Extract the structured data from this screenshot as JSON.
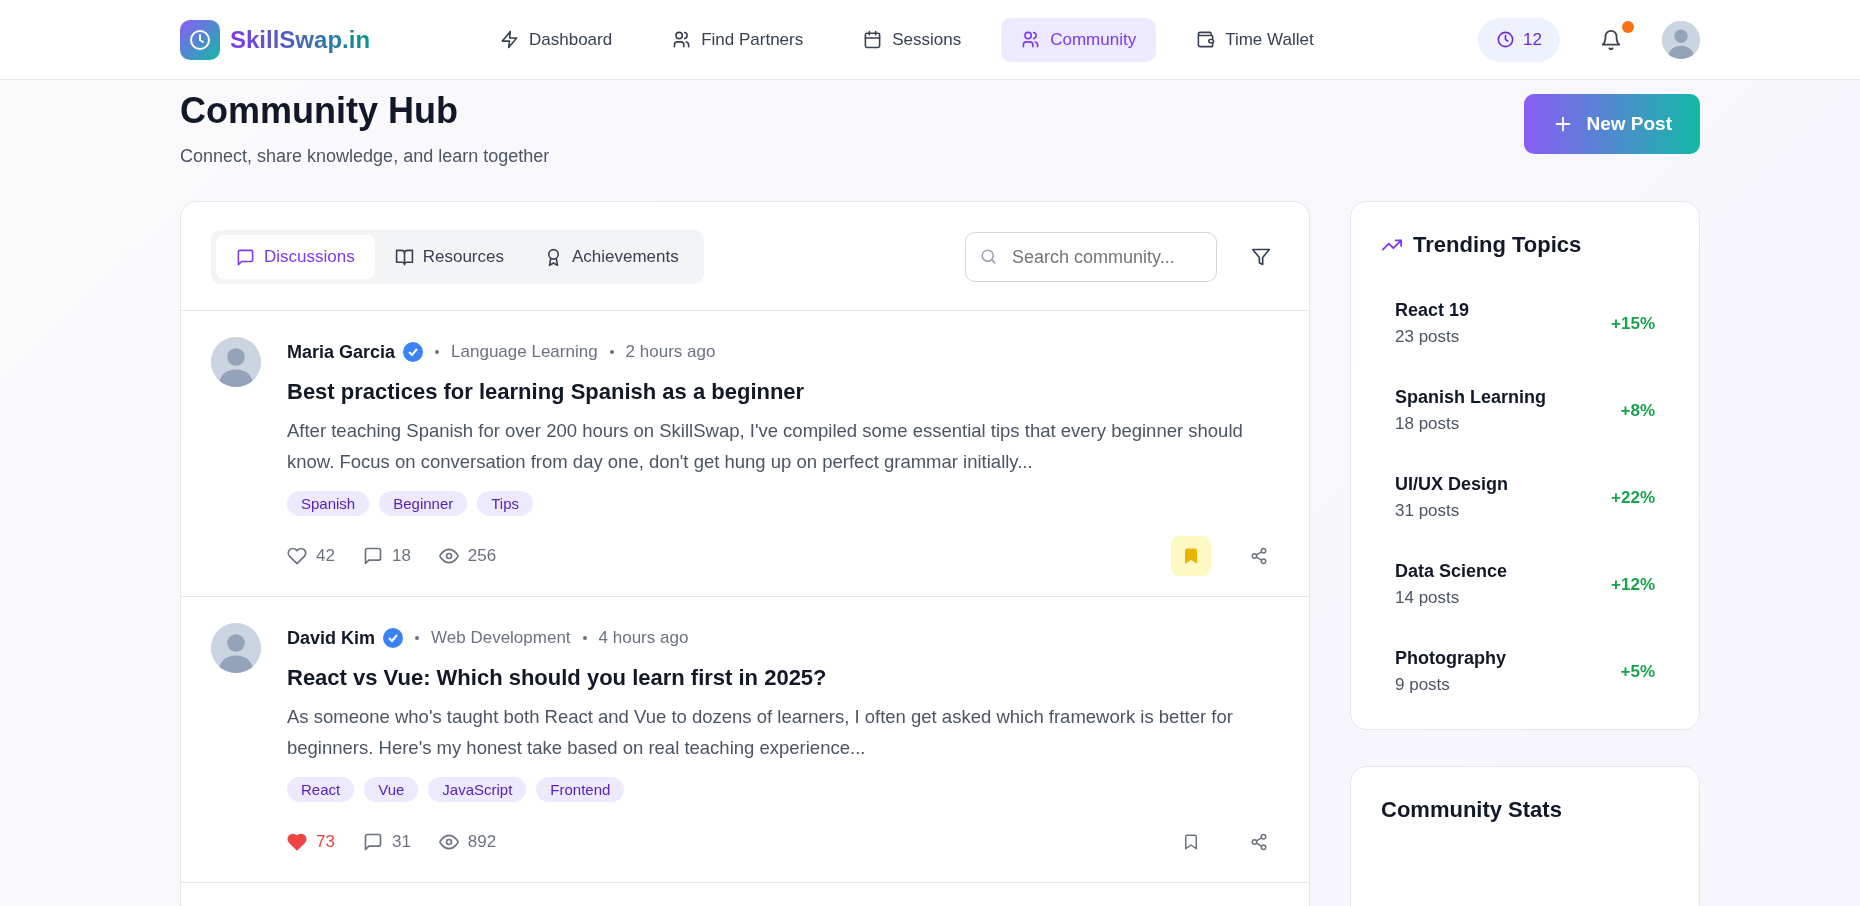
{
  "header": {
    "logo": "SkillSwap.in",
    "nav": [
      {
        "label": "Dashboard",
        "selected": false
      },
      {
        "label": "Find Partners",
        "selected": false
      },
      {
        "label": "Sessions",
        "selected": false
      },
      {
        "label": "Community",
        "selected": true
      },
      {
        "label": "Time Wallet",
        "selected": false
      }
    ],
    "credits": "12",
    "notification": true
  },
  "page": {
    "title": "Community Hub",
    "subtitle": "Connect, share knowledge, and learn together",
    "new_post": "New Post"
  },
  "tabs": [
    {
      "label": "Discussions",
      "selected": true
    },
    {
      "label": "Resources",
      "selected": false
    },
    {
      "label": "Achievements",
      "selected": false
    }
  ],
  "search": {
    "placeholder": "Search community..."
  },
  "posts": [
    {
      "author": "Maria Garcia",
      "verified": true,
      "category": "Language Learning",
      "time": "2 hours ago",
      "title": "Best practices for learning Spanish as a beginner",
      "body": "After teaching Spanish for over 200 hours on SkillSwap, I've compiled some essential tips that every beginner should know. Focus on conversation from day one, don't get hung up on perfect grammar initially...",
      "tags": [
        "Spanish",
        "Beginner",
        "Tips"
      ],
      "likes": "42",
      "comments": "18",
      "views": "256",
      "liked": false,
      "bookmarked": true
    },
    {
      "author": "David Kim",
      "verified": true,
      "category": "Web Development",
      "time": "4 hours ago",
      "title": "React vs Vue: Which should you learn first in 2025?",
      "body": "As someone who's taught both React and Vue to dozens of learners, I often get asked which framework is better for beginners. Here's my honest take based on real teaching experience...",
      "tags": [
        "React",
        "Vue",
        "JavaScript",
        "Frontend"
      ],
      "likes": "73",
      "comments": "31",
      "views": "892",
      "liked": true,
      "bookmarked": false
    }
  ],
  "trending": {
    "title": "Trending Topics",
    "topics": [
      {
        "name": "React 19",
        "posts": "23 posts",
        "change": "+15%"
      },
      {
        "name": "Spanish Learning",
        "posts": "18 posts",
        "change": "+8%"
      },
      {
        "name": "UI/UX Design",
        "posts": "31 posts",
        "change": "+22%"
      },
      {
        "name": "Data Science",
        "posts": "14 posts",
        "change": "+12%"
      },
      {
        "name": "Photography",
        "posts": "9 posts",
        "change": "+5%"
      }
    ]
  },
  "stats": {
    "title": "Community Stats"
  }
}
